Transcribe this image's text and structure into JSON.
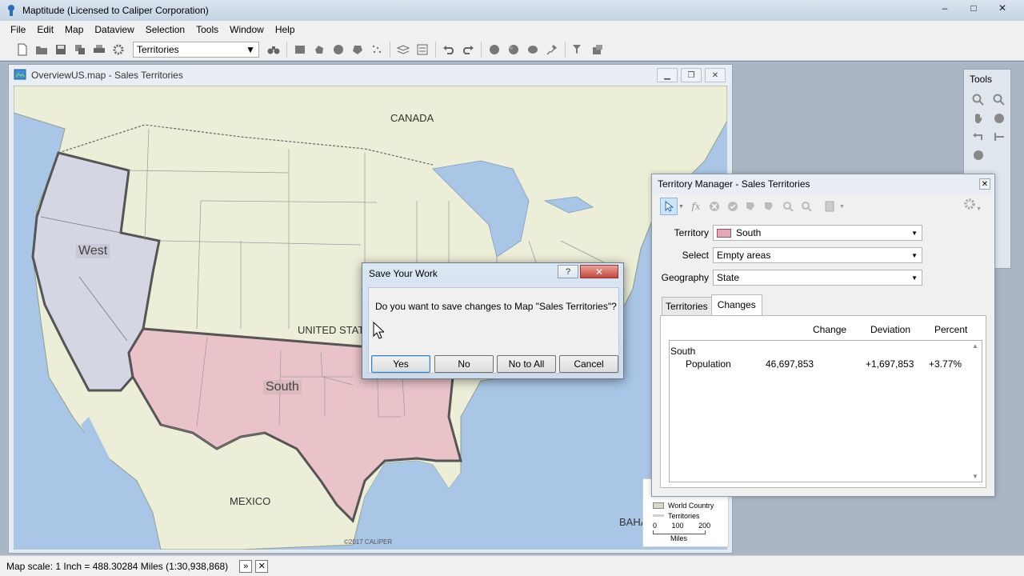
{
  "app": {
    "title": "Maptitude (Licensed to Caliper Corporation)",
    "minimize": "–",
    "maximize": "□",
    "close": "✕"
  },
  "menu": [
    "File",
    "Edit",
    "Map",
    "Dataview",
    "Selection",
    "Tools",
    "Window",
    "Help"
  ],
  "toolbar": {
    "layer_select": "Territories"
  },
  "map_window": {
    "title": "OverviewUS.map - Sales Territories",
    "labels": {
      "canada": "CANADA",
      "west": "West",
      "united_states": "UNITED STAT",
      "south": "South",
      "mexico": "MEXICO",
      "baha": "BAHA",
      "copyright": "©2017 CALIPER"
    },
    "legend": {
      "world_country": "World Country",
      "territories": "Territories",
      "scale_ticks": [
        "0",
        "100",
        "200"
      ],
      "scale_unit": "Miles"
    },
    "colors": {
      "water": "#a9c6e6",
      "land": "#eceed8",
      "west": "#d5d6e3",
      "south": "#e9c3c8"
    }
  },
  "statusbar": {
    "text": "Map scale: 1 Inch = 488.30284 Miles (1:30,938,868)"
  },
  "tools_panel": {
    "title": "Tools"
  },
  "territory_manager": {
    "title": "Territory Manager - Sales Territories",
    "territory_label": "Territory",
    "territory_value": "South",
    "select_label": "Select",
    "select_value": "Empty areas",
    "geography_label": "Geography",
    "geography_value": "State",
    "tabs": [
      "Territories",
      "Changes"
    ],
    "columns": [
      "Change",
      "Deviation",
      "Percent"
    ],
    "group": "South",
    "row": {
      "name": "Population",
      "change": "46,697,853",
      "deviation": "+1,697,853",
      "percent": "+3.77%"
    }
  },
  "dialog": {
    "title": "Save Your Work",
    "help": "?",
    "close": "✕",
    "message": "Do you want to save changes to Map \"Sales Territories\"?",
    "buttons": {
      "yes": "Yes",
      "no": "No",
      "no_to_all": "No to All",
      "cancel": "Cancel"
    }
  }
}
